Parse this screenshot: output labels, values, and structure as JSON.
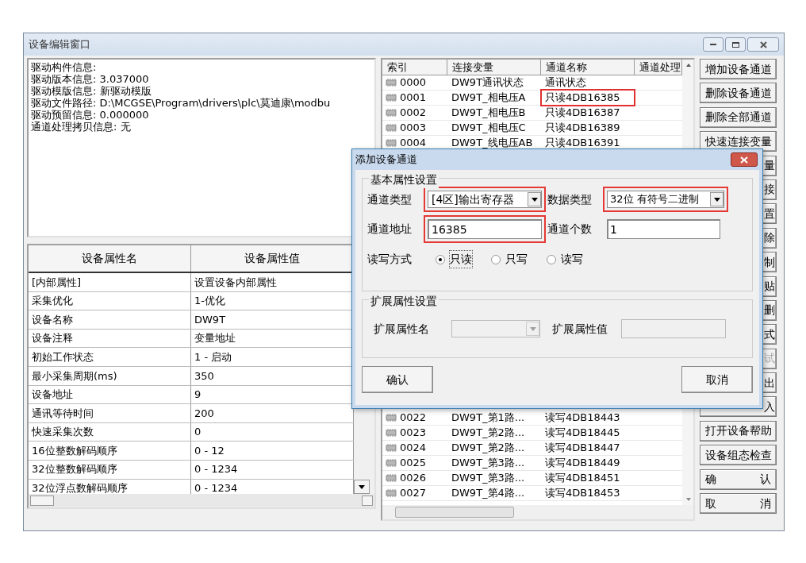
{
  "window": {
    "title": "设备编辑窗口"
  },
  "driver_info": [
    "驱动构件信息:",
    "驱动版本信息: 3.037000",
    "驱动模版信息: 新驱动模版",
    "驱动文件路径: D:\\MCGSE\\Program\\drivers\\plc\\莫迪康\\modbu",
    "驱动预留信息: 0.000000",
    "通道处理拷贝信息: 无"
  ],
  "properties": {
    "columns": [
      "设备属性名",
      "设备属性值"
    ],
    "rows": [
      [
        "[内部属性]",
        "设置设备内部属性"
      ],
      [
        "采集优化",
        "1-优化"
      ],
      [
        "设备名称",
        "DW9T"
      ],
      [
        "设备注释",
        "变量地址"
      ],
      [
        "初始工作状态",
        "1 - 启动"
      ],
      [
        "最小采集周期(ms)",
        "350"
      ],
      [
        "设备地址",
        "9"
      ],
      [
        "通讯等待时间",
        "200"
      ],
      [
        "快速采集次数",
        "0"
      ],
      [
        "16位整数解码顺序",
        "0 - 12"
      ],
      [
        "32位整数解码顺序",
        "0 - 1234"
      ],
      [
        "32位浮点数解码顺序",
        "0 - 1234"
      ]
    ]
  },
  "channels": {
    "columns": [
      "索引",
      "连接变量",
      "通道名称",
      "通道处理"
    ],
    "rows_top": [
      {
        "index": "0000",
        "variable": "DW9T通讯状态",
        "name": "通讯状态",
        "highlighted": false
      },
      {
        "index": "0001",
        "variable": "DW9T_相电压A",
        "name": "只读4DB16385",
        "highlighted": true
      },
      {
        "index": "0002",
        "variable": "DW9T_相电压B",
        "name": "只读4DB16387",
        "highlighted": false
      },
      {
        "index": "0003",
        "variable": "DW9T_相电压C",
        "name": "只读4DB16389",
        "highlighted": false
      },
      {
        "index": "0004",
        "variable": "DW9T_线电压AB",
        "name": "只读4DB16391",
        "highlighted": false
      }
    ],
    "rows_bottom": [
      {
        "index": "0022",
        "variable": "DW9T_第1路...",
        "name": "读写4DB18443",
        "highlighted": false
      },
      {
        "index": "0023",
        "variable": "DW9T_第2路...",
        "name": "读写4DB18445",
        "highlighted": false
      },
      {
        "index": "0024",
        "variable": "DW9T_第2路...",
        "name": "读写4DB18447",
        "highlighted": false
      },
      {
        "index": "0025",
        "variable": "DW9T_第3路...",
        "name": "读写4DB18449",
        "highlighted": false
      },
      {
        "index": "0026",
        "variable": "DW9T_第3路...",
        "name": "读写4DB18451",
        "highlighted": false
      },
      {
        "index": "0027",
        "variable": "DW9T_第4路...",
        "name": "读写4DB18453",
        "highlighted": false
      }
    ]
  },
  "side_buttons": [
    {
      "label": "增加设备通道",
      "kind": "full",
      "disabled": false
    },
    {
      "label": "删除设备通道",
      "kind": "full",
      "disabled": false
    },
    {
      "label": "删除全部通道",
      "kind": "full",
      "disabled": false
    },
    {
      "label": "快速连接变量",
      "kind": "full",
      "disabled": false
    },
    {
      "label": "量",
      "kind": "partial",
      "disabled": false
    },
    {
      "label": "接",
      "kind": "partial",
      "disabled": false
    },
    {
      "label": "置",
      "kind": "partial",
      "disabled": false
    },
    {
      "label": "除",
      "kind": "partial",
      "disabled": false
    },
    {
      "label": "制",
      "kind": "partial",
      "disabled": false
    },
    {
      "label": "贴",
      "kind": "partial",
      "disabled": false
    },
    {
      "label": "删",
      "kind": "partial",
      "disabled": false
    },
    {
      "label": "式",
      "kind": "partial",
      "disabled": false
    },
    {
      "label": "试",
      "kind": "partial",
      "disabled": true
    },
    {
      "label": "出",
      "kind": "partial",
      "disabled": false
    },
    {
      "label": "入",
      "kind": "partial",
      "disabled": false
    },
    {
      "label": "打开设备帮助",
      "kind": "full",
      "disabled": false
    },
    {
      "label": "设备组态检查",
      "kind": "full",
      "disabled": false
    },
    {
      "label": "确 认",
      "kind": "spread",
      "disabled": false
    },
    {
      "label": "取 消",
      "kind": "spread",
      "disabled": false
    }
  ],
  "dialog": {
    "title": "添加设备通道",
    "basic_group": "基本属性设置",
    "channel_type": {
      "label": "通道类型",
      "value": "[4区]输出寄存器",
      "highlighted": true
    },
    "data_type": {
      "label": "数据类型",
      "value": "32位 有符号二进制",
      "highlighted": true
    },
    "address": {
      "label": "通道地址",
      "value": "16385",
      "highlighted": true
    },
    "count": {
      "label": "通道个数",
      "value": "1"
    },
    "rw_label": "读写方式",
    "rw_options": [
      {
        "label": "只读",
        "selected": true
      },
      {
        "label": "只写",
        "selected": false
      },
      {
        "label": "读写",
        "selected": false
      }
    ],
    "ext_group": "扩展属性设置",
    "ext_name_label": "扩展属性名",
    "ext_value_label": "扩展属性值",
    "ok": "确认",
    "cancel": "取消"
  }
}
